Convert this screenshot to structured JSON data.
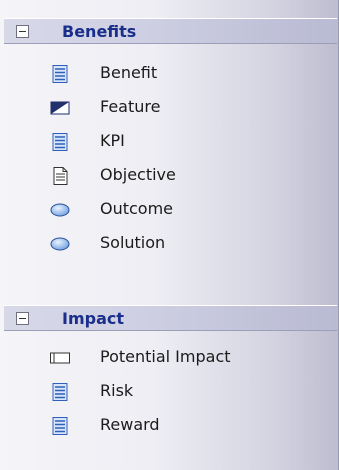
{
  "sections": [
    {
      "title": "Benefits",
      "items": [
        {
          "label": "Benefit",
          "icon": "list-element-icon"
        },
        {
          "label": "Feature",
          "icon": "feature-icon"
        },
        {
          "label": "KPI",
          "icon": "list-element-icon"
        },
        {
          "label": "Objective",
          "icon": "document-icon"
        },
        {
          "label": "Outcome",
          "icon": "ellipse-icon"
        },
        {
          "label": "Solution",
          "icon": "ellipse-icon"
        }
      ]
    },
    {
      "title": "Impact",
      "items": [
        {
          "label": "Potential Impact",
          "icon": "impact-icon"
        },
        {
          "label": "Risk",
          "icon": "list-element-icon"
        },
        {
          "label": "Reward",
          "icon": "list-element-icon"
        }
      ]
    }
  ]
}
